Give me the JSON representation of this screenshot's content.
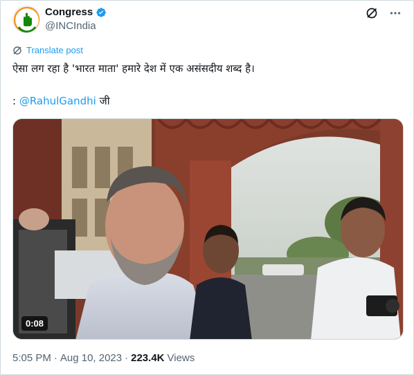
{
  "author": {
    "display_name": "Congress",
    "handle": "@INCIndia",
    "verified": true
  },
  "actions": {
    "grok_icon": "grok-slash-icon",
    "more_icon": "more-dots-icon"
  },
  "translate": {
    "label": "Translate post"
  },
  "tweet": {
    "text_line1": "ऐसा लग रहा है 'भारत माता' हमारे देश में एक असंसदीय शब्द है।",
    "prefix": ": ",
    "mention": "@RahulGandhi",
    "suffix": " जी"
  },
  "media": {
    "duration": "0:08"
  },
  "meta": {
    "time": "5:05 PM",
    "separator": "·",
    "date": "Aug 10, 2023",
    "separator2": "·",
    "views": "223.4K",
    "views_label": "Views"
  },
  "colors": {
    "accent": "#1d9bf0",
    "muted": "#536471",
    "text": "#0f1419"
  }
}
